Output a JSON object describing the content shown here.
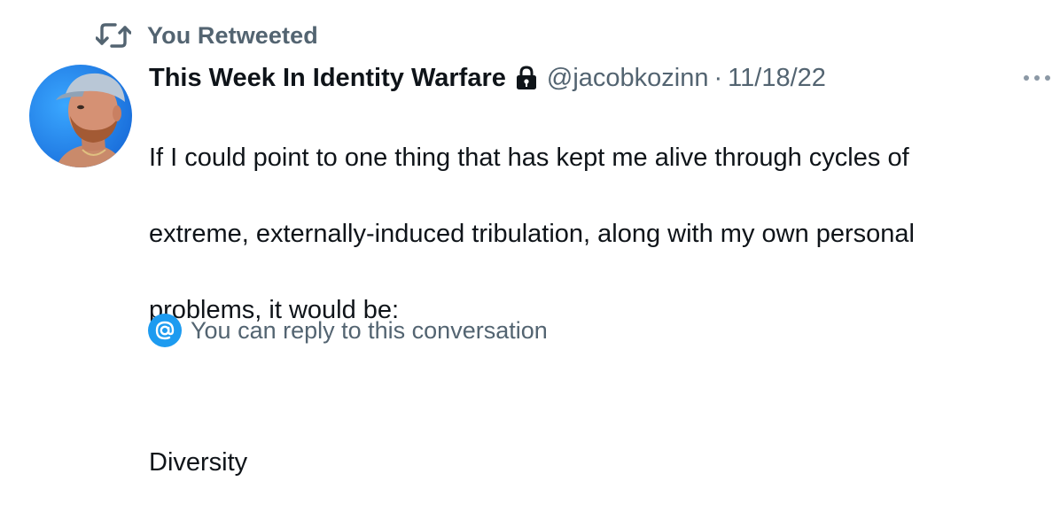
{
  "social_context": {
    "icon": "retweet-icon",
    "text": "You Retweeted"
  },
  "tweet": {
    "author": {
      "display_name": "This Week In Identity Warfare",
      "protected_icon": "lock-icon",
      "handle": "@jacobkozinn",
      "avatar_icon": "avatar"
    },
    "separator": "·",
    "date": "11/18/22",
    "body_lines": [
      "If I could point to one thing that has kept me alive through cycles of",
      "extreme, externally-induced tribulation, along with my own personal",
      "problems, it would be:",
      "",
      "Diversity"
    ],
    "more_icon": "more-icon",
    "reply_restriction": {
      "icon": "at-icon",
      "text": "You can reply to this conversation"
    }
  },
  "colors": {
    "primary_text": "#0f1419",
    "secondary_text": "#536471",
    "accent": "#1d9bf0"
  }
}
